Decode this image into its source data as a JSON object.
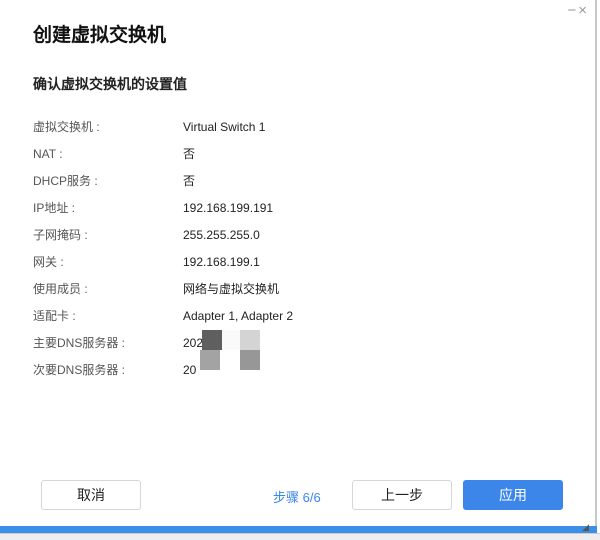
{
  "window": {
    "minimize": "−",
    "close": "×"
  },
  "title": "创建虚拟交换机",
  "subtitle": "确认虚拟交换机的设置值",
  "rows": [
    {
      "label": "虚拟交换机 :",
      "value": "Virtual Switch 1"
    },
    {
      "label": "NAT :",
      "value": "否"
    },
    {
      "label": "DHCP服务 :",
      "value": "否"
    },
    {
      "label": "IP地址 :",
      "value": "192.168.199.191"
    },
    {
      "label": "子网掩码 :",
      "value": "255.255.255.0"
    },
    {
      "label": "网关 :",
      "value": "192.168.199.1"
    },
    {
      "label": "使用成员 :",
      "value": "网络与虚拟交换机"
    },
    {
      "label": "适配卡 :",
      "value": "Adapter 1, Adapter 2"
    },
    {
      "label": "主要DNS服务器 :",
      "value": "202"
    },
    {
      "label": "次要DNS服务器 :",
      "value": "20"
    }
  ],
  "footer": {
    "cancel": "取消",
    "step": "步骤 6/6",
    "back": "上一步",
    "apply": "应用"
  },
  "colors": {
    "accent": "#3b86e8"
  }
}
